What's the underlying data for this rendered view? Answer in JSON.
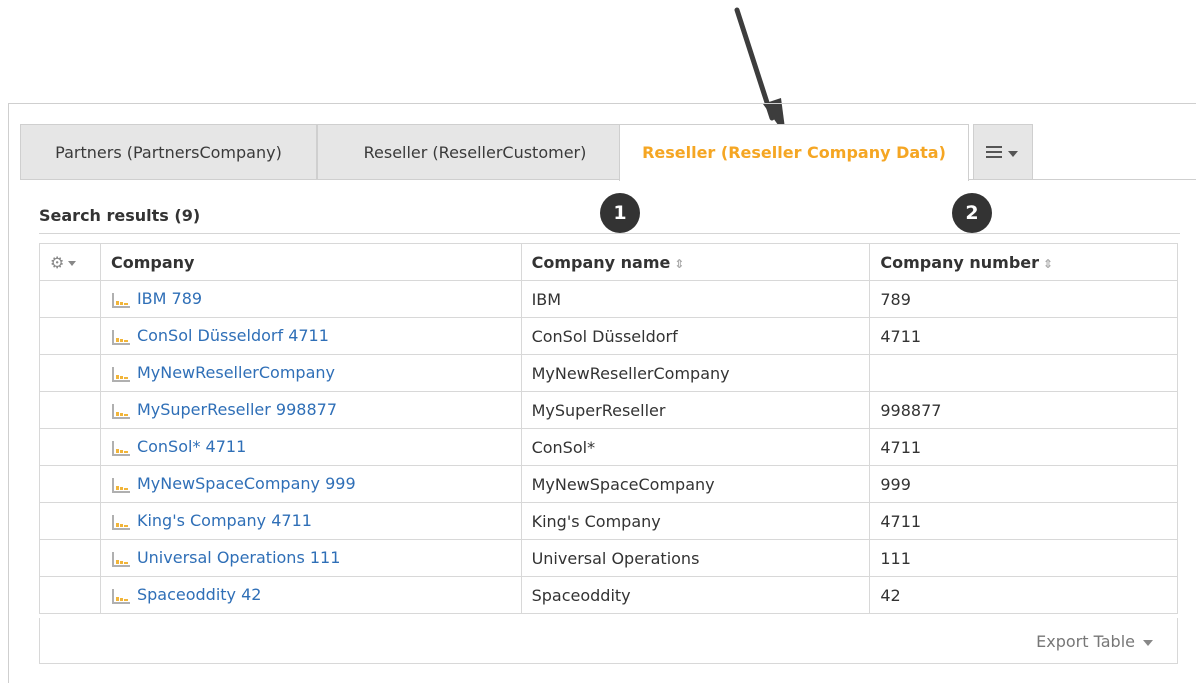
{
  "tabs": [
    {
      "label": "Partners (PartnersCompany)",
      "active": false
    },
    {
      "label": "Reseller (ResellerCustomer)",
      "active": false
    },
    {
      "label": "Reseller (Reseller Company Data)",
      "active": true
    }
  ],
  "tab_menu_icon": "list-menu-icon",
  "search": {
    "title": "Search results (9)"
  },
  "badges": [
    "1",
    "2"
  ],
  "table": {
    "headers": {
      "settings_icon": "gear-icon",
      "company": "Company",
      "company_name": "Company name",
      "company_number": "Company number",
      "sort_icon": "⇕"
    },
    "rows": [
      {
        "company": "IBM 789",
        "name": "IBM",
        "number": "789"
      },
      {
        "company": "ConSol Düsseldorf 4711",
        "name": "ConSol Düsseldorf",
        "number": "4711"
      },
      {
        "company": "MyNewResellerCompany",
        "name": "MyNewResellerCompany",
        "number": ""
      },
      {
        "company": "MySuperReseller 998877",
        "name": "MySuperReseller",
        "number": "998877"
      },
      {
        "company": "ConSol* 4711",
        "name": "ConSol*",
        "number": "4711"
      },
      {
        "company": "MyNewSpaceCompany 999",
        "name": "MyNewSpaceCompany",
        "number": "999"
      },
      {
        "company": "King's Company 4711",
        "name": "King's Company",
        "number": "4711"
      },
      {
        "company": "Universal Operations 111",
        "name": "Universal Operations",
        "number": "111"
      },
      {
        "company": "Spaceoddity 42",
        "name": "Spaceoddity",
        "number": "42"
      }
    ]
  },
  "footer": {
    "export_label": "Export Table"
  },
  "colors": {
    "active_tab": "#f5a623",
    "link": "#2f6fb7",
    "badge": "#333333"
  }
}
